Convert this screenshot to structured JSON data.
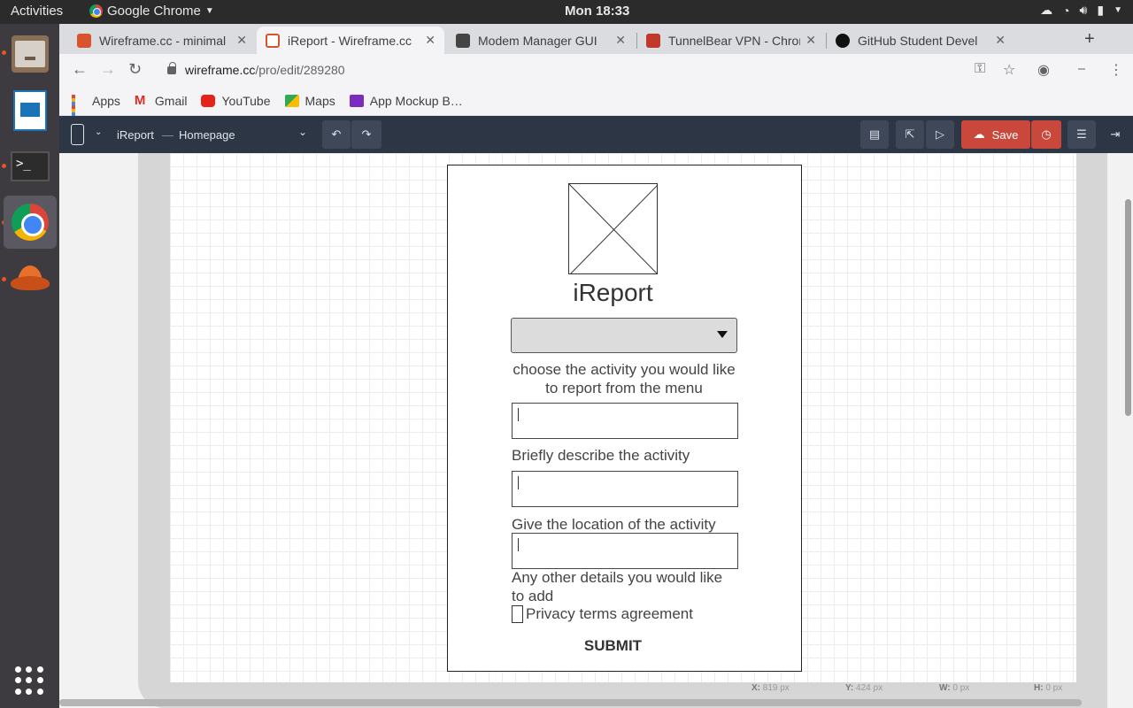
{
  "topbar": {
    "activities": "Activities",
    "app_name": "Google Chrome",
    "clock": "Mon 18:33"
  },
  "tabs": [
    {
      "title": "Wireframe.cc - minimal",
      "active": false,
      "favicon_color": "#d9532c"
    },
    {
      "title": "iReport - Wireframe.cc",
      "active": true,
      "favicon_color": "#d9532c"
    },
    {
      "title": "Modem Manager GUI",
      "active": false,
      "favicon_color": "#444444"
    },
    {
      "title": "TunnelBear VPN - Chrome",
      "active": false,
      "favicon_color": "#c0392b"
    },
    {
      "title": "GitHub Student Devel",
      "active": false,
      "favicon_color": "#111111"
    }
  ],
  "address": {
    "host": "wireframe.cc",
    "path": "/pro/edit/289280"
  },
  "bookmarks": [
    {
      "label": "Apps",
      "icon": "apps-grid-icon"
    },
    {
      "label": "Gmail",
      "icon": "gmail-icon"
    },
    {
      "label": "YouTube",
      "icon": "youtube-icon"
    },
    {
      "label": "Maps",
      "icon": "maps-icon"
    },
    {
      "label": "App Mockup B…",
      "icon": "mockup-icon"
    }
  ],
  "app_toolbar": {
    "project": "iReport",
    "separator": "—",
    "page": "Homepage",
    "save_label": "Save"
  },
  "mockup": {
    "title": "iReport",
    "select_help": "choose the activity you would like to report from the menu",
    "describe_label": "Briefly describe the activity",
    "location_label": "Give the location of the activity",
    "details_label": "Any other details you would like to add",
    "privacy_label": "Privacy terms agreement",
    "submit_label": "SUBMIT"
  },
  "coords": {
    "x_label": "X:",
    "x_value": "819 px",
    "y_label": "Y:",
    "y_value": "424 px",
    "w_label": "W:",
    "w_value": "0 px",
    "h_label": "H:",
    "h_value": "0 px"
  },
  "colors": {
    "app_toolbar": "#2d3645",
    "save_button": "#c9483b",
    "dock": "#3d3b3f"
  }
}
